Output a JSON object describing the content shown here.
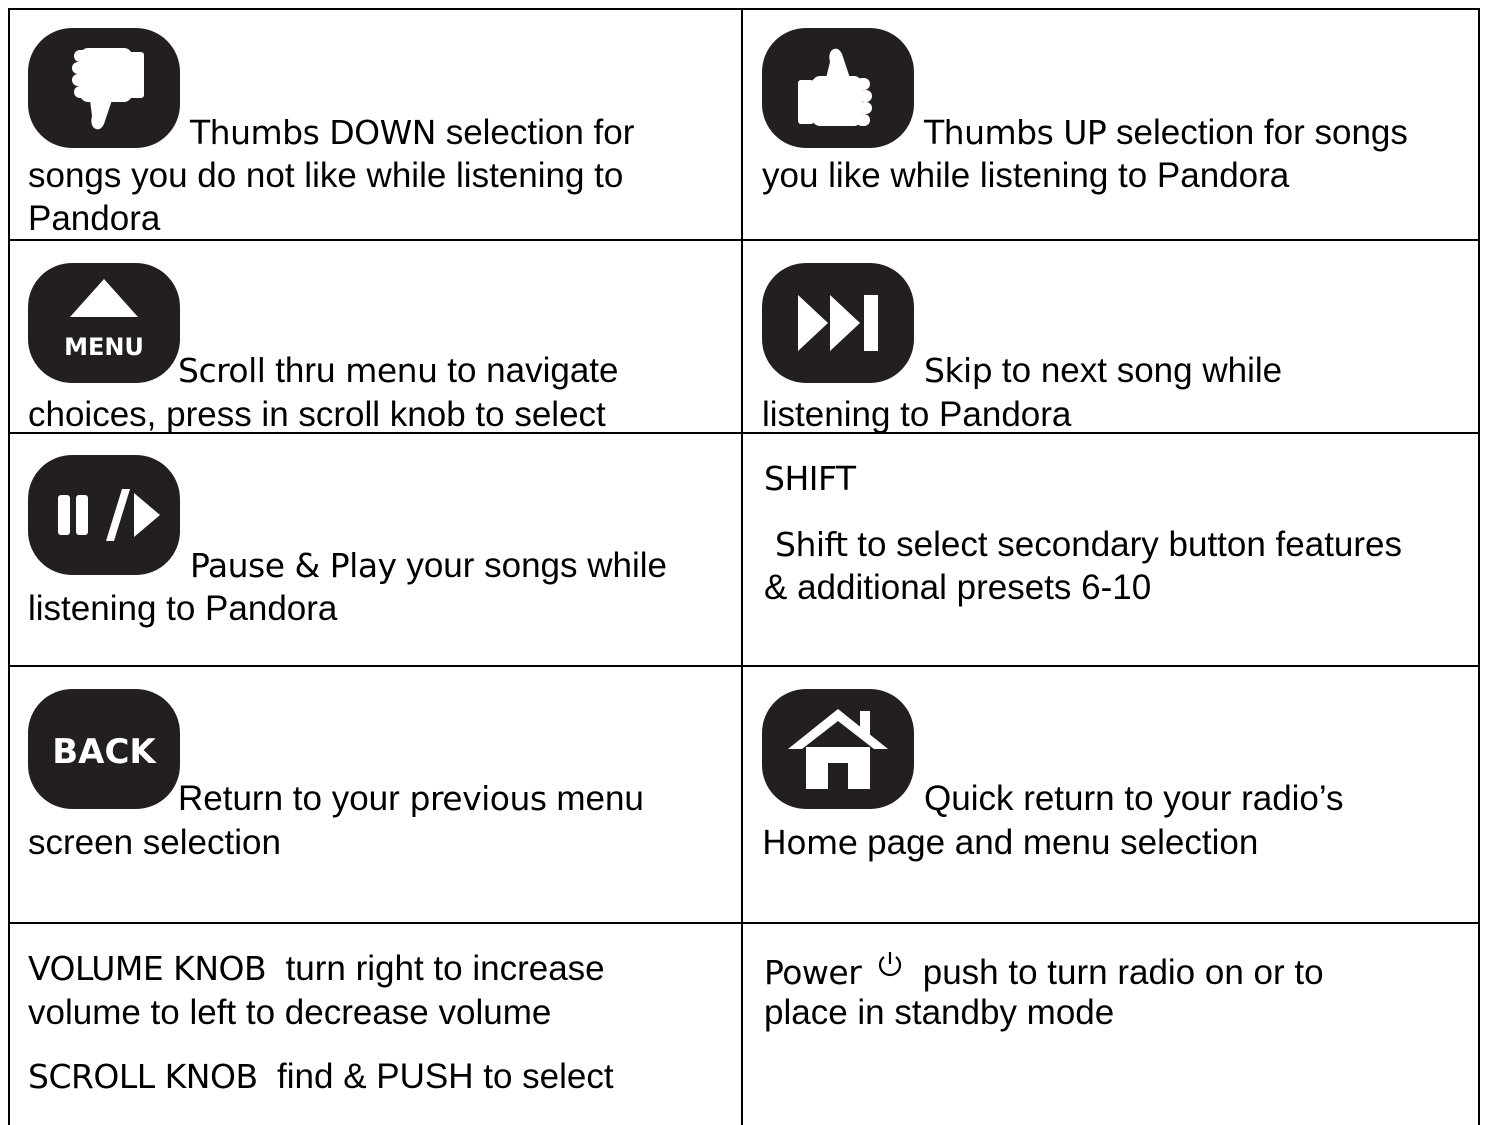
{
  "cells": {
    "thumbs_down": {
      "icon": "thumbs-down-icon",
      "line1_kw": "Thumbs DOWN",
      "line1_rest": " selection for",
      "line2": "songs you do not like while listening to",
      "line3": "Pandora"
    },
    "thumbs_up": {
      "icon": "thumbs-up-icon",
      "line1_kw": "Thumbs UP",
      "line1_rest": " selection for songs",
      "line2": "you like while listening to Pandora"
    },
    "menu": {
      "icon": "menu-up-arrow-icon",
      "icon_label": "MENU",
      "line1_kw1": "Scroll",
      "line1_mid": " thru ",
      "line1_kw2": "menu",
      "line1_rest": " to navigate",
      "line2": "choices, press in scroll knob to select"
    },
    "skip": {
      "icon": "skip-next-icon",
      "line1_kw": "Skip",
      "line1_rest": " to next song while",
      "line2": "listening to Pandora"
    },
    "pause_play": {
      "icon": "pause-play-icon",
      "line1_kw": "Pause & Play",
      "line1_rest": " your songs while",
      "line2": "listening to Pandora"
    },
    "shift": {
      "heading": "SHIFT",
      "line1_kw": "Shift",
      "line1_rest": " to select secondary button features",
      "line2": "& additional presets 6-10"
    },
    "back": {
      "icon": "back-icon",
      "icon_label": "BACK",
      "line1_pre": "Return to your ",
      "line1_kw": "previous",
      "line1_rest": " menu",
      "line2": "screen selection"
    },
    "home": {
      "icon": "home-icon",
      "line1": "Quick return to your radio’s",
      "line2_kw": "Home",
      "line2_rest": " page and menu selection"
    },
    "volume": {
      "line1_kw": "VOLUME KNOB",
      "line1_rest": "  turn right to increase",
      "line2": "volume to left to decrease volume",
      "line3_kw": "SCROLL KNOB",
      "line3_rest": "  find & PUSH to select"
    },
    "power": {
      "line1_kw": "Power",
      "power_icon": "power-icon",
      "line1_rest": "push to turn radio on or to",
      "line2": "place in standby mode"
    }
  }
}
